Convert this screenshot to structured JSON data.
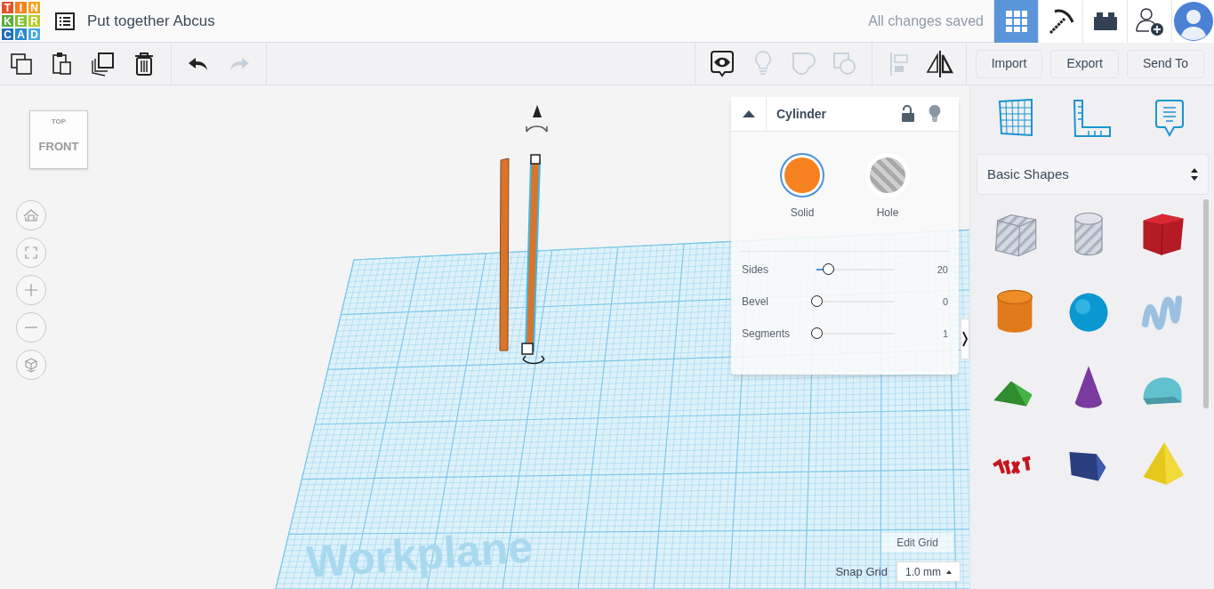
{
  "logo": {
    "letters": [
      "T",
      "I",
      "N",
      "K",
      "E",
      "R",
      "C",
      "A",
      "D"
    ]
  },
  "header": {
    "title": "Put together Abcus",
    "save_status": "All changes saved",
    "nav": [
      {
        "kind": "grid",
        "selected": true
      },
      {
        "kind": "pickaxe",
        "selected": false
      },
      {
        "kind": "brick",
        "selected": false
      },
      {
        "kind": "add-user",
        "selected": false
      },
      {
        "kind": "avatar",
        "selected": false
      }
    ]
  },
  "toolbar": {
    "tools": [
      {
        "kind": "copy",
        "disabled": false
      },
      {
        "kind": "paste",
        "disabled": false
      },
      {
        "kind": "duplicate",
        "disabled": false
      },
      {
        "kind": "delete",
        "disabled": false
      },
      {
        "kind": "sep"
      },
      {
        "kind": "undo",
        "disabled": false
      },
      {
        "kind": "redo",
        "disabled": true
      }
    ],
    "view_tools": [
      {
        "kind": "notes",
        "disabled": false
      },
      {
        "kind": "bulb",
        "disabled": true
      },
      {
        "kind": "group",
        "disabled": true
      },
      {
        "kind": "ungroup",
        "disabled": true
      },
      {
        "kind": "sep"
      },
      {
        "kind": "align",
        "disabled": true
      },
      {
        "kind": "mirror",
        "disabled": false
      }
    ],
    "buttons": [
      "Import",
      "Export",
      "Send To"
    ]
  },
  "view_cube": {
    "top": "TOP",
    "front": "FRONT"
  },
  "view_controls": [
    {
      "kind": "home"
    },
    {
      "kind": "fit"
    },
    {
      "kind": "zoom-in"
    },
    {
      "kind": "zoom-out"
    },
    {
      "kind": "perspective"
    }
  ],
  "workplane": {
    "label": "Workplane"
  },
  "shape_panel": {
    "title": "Cylinder",
    "locked": false,
    "modes": [
      {
        "label": "Solid",
        "kind": "solid",
        "selected": true
      },
      {
        "label": "Hole",
        "kind": "hole",
        "selected": false
      }
    ],
    "params": [
      {
        "name": "Sides",
        "level": 0.15,
        "reading": "20"
      },
      {
        "name": "Bevel",
        "level": 0,
        "reading": "0"
      },
      {
        "name": "Segments",
        "level": 0,
        "reading": "1"
      }
    ]
  },
  "edit_grid": "Edit Grid",
  "snap_grid": {
    "label": "Snap Grid",
    "value": "1.0 mm"
  },
  "library": {
    "tabs": [
      {
        "kind": "grid",
        "selected": false
      },
      {
        "kind": "ruler",
        "selected": false
      },
      {
        "kind": "note",
        "selected": false
      }
    ],
    "category": "Basic Shapes",
    "shapes": [
      {
        "kind": "box-hole"
      },
      {
        "kind": "cylinder-hole"
      },
      {
        "kind": "box"
      },
      {
        "kind": "cylinder"
      },
      {
        "kind": "sphere"
      },
      {
        "kind": "scribble"
      },
      {
        "kind": "roof"
      },
      {
        "kind": "cone"
      },
      {
        "kind": "round-roof"
      },
      {
        "kind": "text"
      },
      {
        "kind": "wedge"
      },
      {
        "kind": "pyramid"
      }
    ]
  }
}
